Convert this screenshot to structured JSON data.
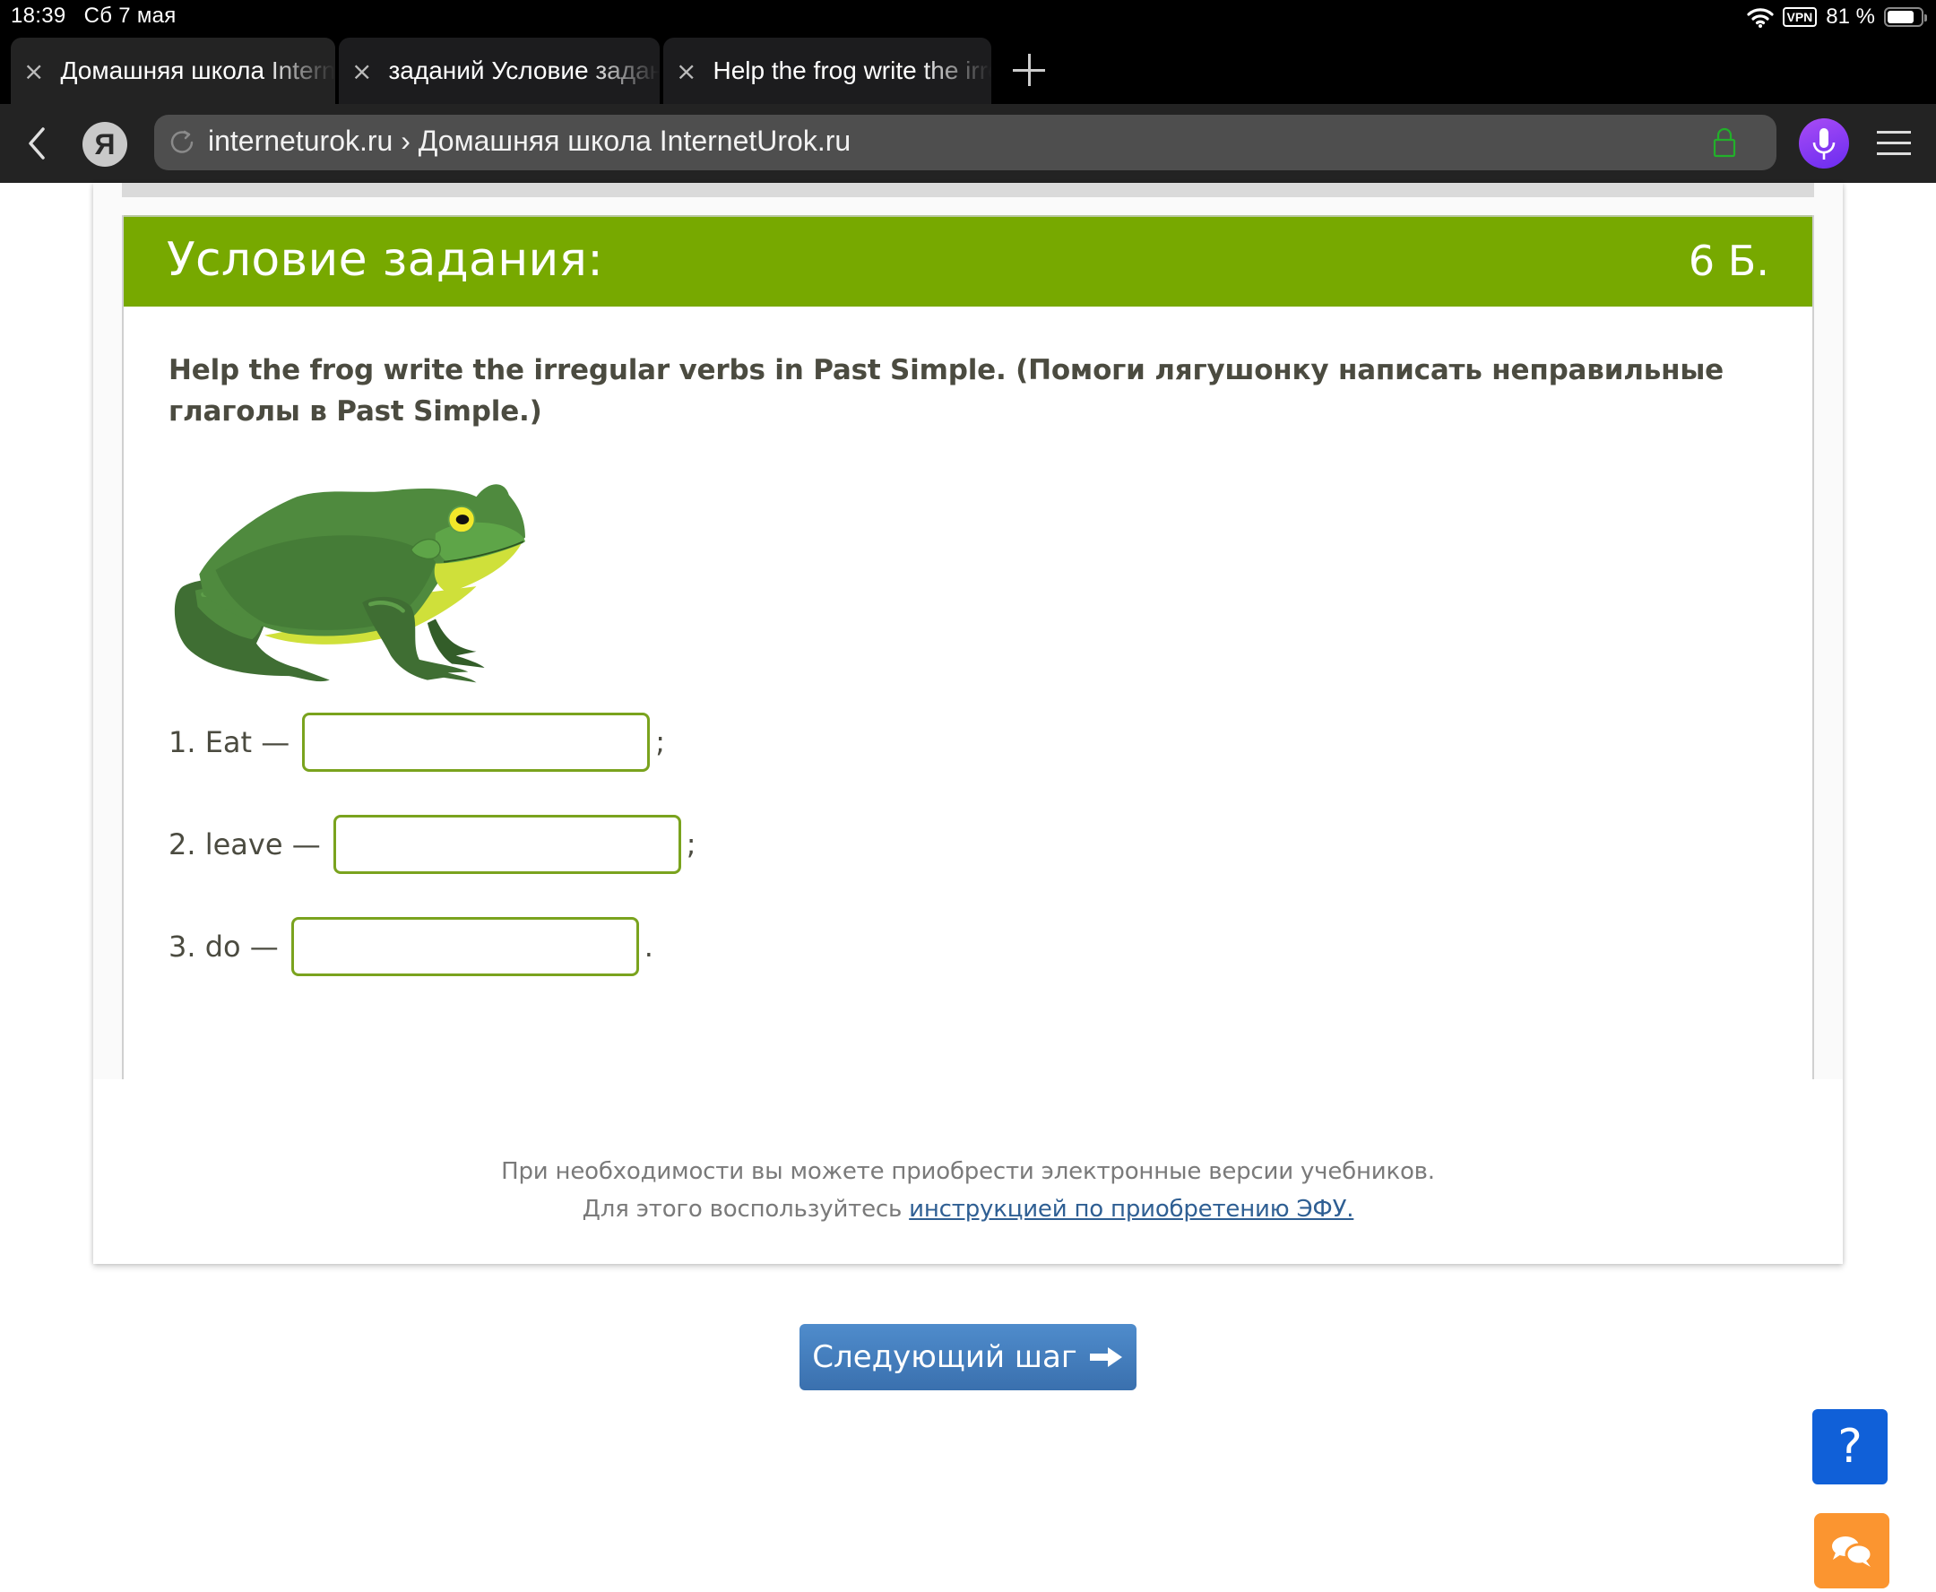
{
  "status_bar": {
    "time": "18:39",
    "date": "Сб 7 мая",
    "vpn_label": "VPN",
    "battery_text": "81 %",
    "battery_level_percent": 81
  },
  "tabs": [
    {
      "title": "Домашняя школа InternetUrok.ru",
      "active": true
    },
    {
      "title": "заданий Условие задания",
      "active": false
    },
    {
      "title": "Help the frog write the irregular",
      "active": false
    }
  ],
  "address_bar": {
    "yandex_logo": "Я",
    "url_display": "interneturok.ru › Домашняя школа InternetUrok.ru"
  },
  "task": {
    "header_title": "Условие задания:",
    "points": "6 Б.",
    "instruction": "Help the frog write the irregular verbs in Past Simple. (Помоги лягушонку написать неправильные глаголы в Past Simple.)",
    "image_alt": "frog-illustration",
    "questions": [
      {
        "label": "1. Eat —",
        "value": "",
        "placeholder": "",
        "punct": ";"
      },
      {
        "label": "2. leave —",
        "value": "",
        "placeholder": "",
        "punct": ";"
      },
      {
        "label": "3. do —",
        "value": "",
        "placeholder": "",
        "punct": "."
      }
    ]
  },
  "footer": {
    "line1": "При необходимости вы можете приобрести электронные версии учебников.",
    "line2_prefix": "Для этого воспользуйтесь ",
    "line2_link": "инструкцией по приобретению ЭФУ."
  },
  "buttons": {
    "next_step": "Следующий шаг",
    "help": "?"
  },
  "colors": {
    "header_green": "#77a900",
    "input_border": "#7aa31e",
    "next_button_blue": "#4680c0",
    "help_blue": "#1060d8",
    "chat_orange": "#fb9530",
    "link_blue": "#2f5f93"
  }
}
